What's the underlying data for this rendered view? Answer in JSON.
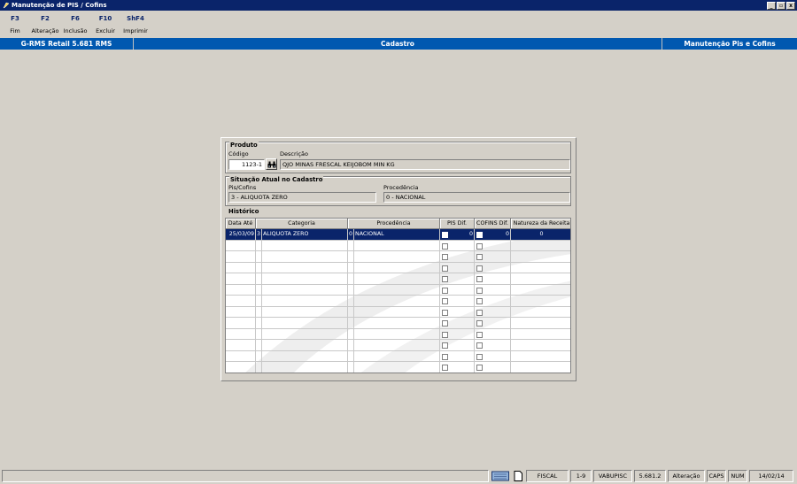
{
  "window": {
    "title": "Manutenção de PIS / Cofins",
    "controls": [
      "_",
      "▫",
      "x"
    ]
  },
  "toolbar": {
    "keys": [
      {
        "key": "F3",
        "label": "Fim"
      },
      {
        "key": "F2",
        "label": "Alteração"
      },
      {
        "key": "F6",
        "label": "Inclusão"
      },
      {
        "key": "F10",
        "label": "Excluir"
      },
      {
        "key": "ShF4",
        "label": "Imprimir"
      }
    ]
  },
  "header": {
    "left": "G-RMS Retail 5.681 RMS",
    "center": "Cadastro",
    "right": "Manutenção Pis e Cofins"
  },
  "produto": {
    "group_title": "Produto",
    "codigo_label": "Código",
    "codigo_value": "1123-1",
    "descricao_label": "Descrição",
    "descricao_value": "QJO MINAS FRESCAL KEIJOBOM MIN KG"
  },
  "situacao": {
    "group_title": "Situação Atual no Cadastro",
    "pis_label": "Pis/Cofins",
    "pis_value": "3 - ALIQUOTA ZERO",
    "proc_label": "Procedência",
    "proc_value": "0 - NACIONAL"
  },
  "historico": {
    "group_title": "Histórico",
    "columns": [
      "Data Até",
      "Categoria",
      "Procedência",
      "PIS Dif.",
      "COFINS Dif.",
      "Natureza da Receita"
    ],
    "rows": [
      {
        "data": "25/03/09",
        "cat_code": "3",
        "cat": "ALIQUOTA ZERO",
        "proc_code": "0",
        "proc": "NACIONAL",
        "pis": "0",
        "cofins": "0",
        "natureza": "0"
      }
    ],
    "empty_rows": 12
  },
  "status": {
    "cells": [
      "FISCAL",
      "1-9",
      "VABUPISC",
      "5.681.2",
      "Alteração",
      "CAPS",
      "NUM",
      "14/02/14"
    ]
  }
}
